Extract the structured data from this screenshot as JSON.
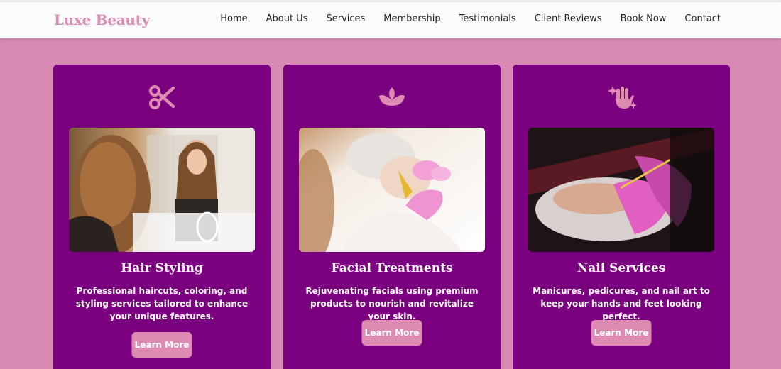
{
  "brand": {
    "logo": "Luxe Beauty",
    "accent": "#dd8bb3",
    "card_color": "#7b0080",
    "page_bg": "#d98ab4"
  },
  "nav": {
    "items": [
      {
        "label": "Home"
      },
      {
        "label": "About Us"
      },
      {
        "label": "Services"
      },
      {
        "label": "Membership"
      },
      {
        "label": "Testimonials"
      },
      {
        "label": "Client Reviews"
      },
      {
        "label": "Book Now"
      },
      {
        "label": "Contact"
      }
    ]
  },
  "services": [
    {
      "icon": "scissors-icon",
      "title": "Hair Styling",
      "description": "Professional haircuts, coloring, and styling services tailored to enhance your unique features.",
      "button": "Learn More"
    },
    {
      "icon": "lotus-icon",
      "title": "Facial Treatments",
      "description": "Rejuvenating facials using premium products to nourish and revitalize your skin.",
      "button": "Learn More"
    },
    {
      "icon": "sparkle-hand-icon",
      "title": "Nail Services",
      "description": "Manicures, pedicures, and nail art to keep your hands and feet looking perfect.",
      "button": "Learn More"
    }
  ]
}
